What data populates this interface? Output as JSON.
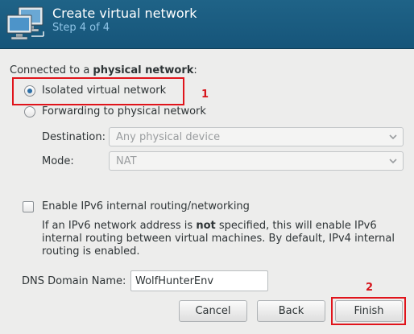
{
  "header": {
    "title": "Create virtual network",
    "subtitle": "Step 4 of 4",
    "icon": "network-computers-icon"
  },
  "connection": {
    "label_prefix": "Connected to a ",
    "label_bold": "physical network",
    "label_suffix": ":",
    "options": [
      {
        "label": "Isolated virtual network",
        "checked": true
      },
      {
        "label": "Forwarding to physical network",
        "checked": false
      }
    ],
    "destination": {
      "label": "Destination:",
      "value": "Any physical device"
    },
    "mode": {
      "label": "Mode:",
      "value": "NAT"
    }
  },
  "ipv6": {
    "label": "Enable IPv6 internal routing/networking",
    "checked": false,
    "desc_part1": "If an IPv6 network address is ",
    "desc_bold": "not",
    "desc_part2": " specified, this will enable IPv6 internal routing between virtual machines.  By default, IPv4 internal routing is enabled."
  },
  "dns": {
    "label": "DNS Domain Name:",
    "value": "WolfHunterEnv"
  },
  "buttons": {
    "cancel": "Cancel",
    "back": "Back",
    "finish": "Finish"
  },
  "annotations": {
    "first": "1",
    "second": "2",
    "color": "#e0141b"
  },
  "colors": {
    "header_bg": "#1f6387",
    "header_subtitle": "#8fc4e6",
    "window_bg": "#ededec"
  }
}
